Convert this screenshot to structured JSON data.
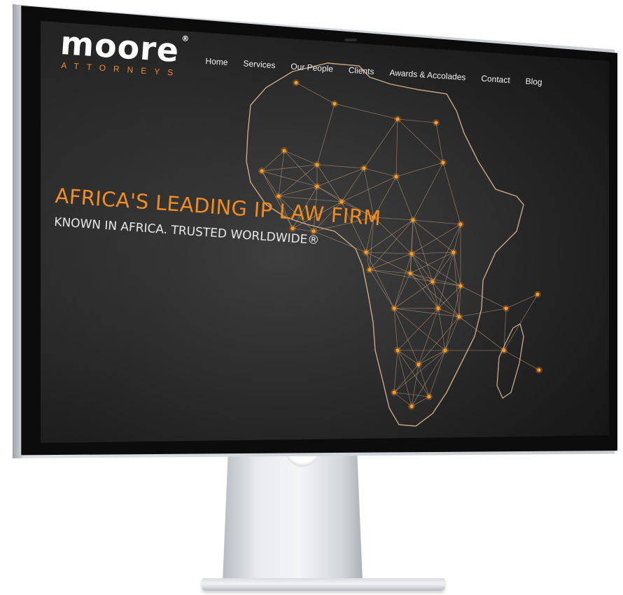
{
  "brand": {
    "logo_word": "moore",
    "logo_reg": "®",
    "logo_sub": "ATTORNEYS",
    "accent_color": "#f08c1e"
  },
  "nav": {
    "items": [
      {
        "label": "Home"
      },
      {
        "label": "Services"
      },
      {
        "label": "Our People"
      },
      {
        "label": "Clients"
      },
      {
        "label": "Awards & Accolades"
      },
      {
        "label": "Contact"
      },
      {
        "label": "Blog"
      }
    ]
  },
  "hero": {
    "headline": "AFRICA'S LEADING IP LAW FIRM",
    "tagline": "KNOWN IN AFRICA. TRUSTED WORLDWIDE®"
  },
  "background": {
    "image": "africa-network-map",
    "line_color": "#c9a886",
    "node_color": "#ff9a1f"
  }
}
